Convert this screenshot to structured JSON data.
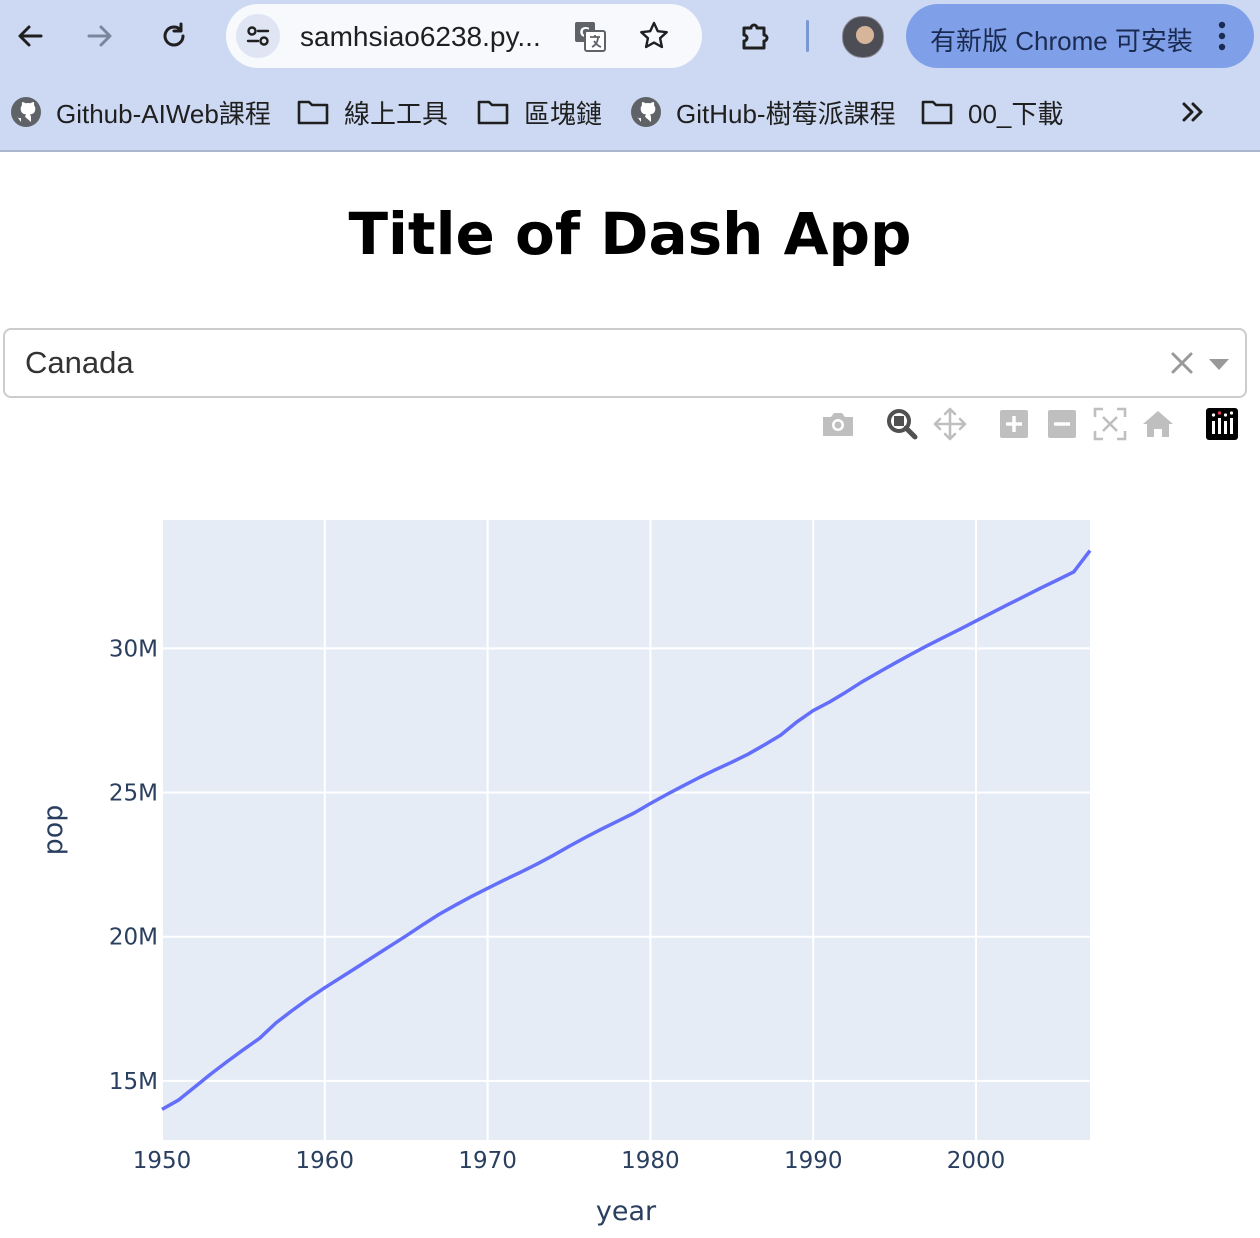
{
  "browser": {
    "url": "samhsiao6238.py...",
    "update_button": "有新版 Chrome 可安裝",
    "bookmarks": [
      {
        "label": "Github-AIWeb課程",
        "icon": "github-icon"
      },
      {
        "label": "線上工具",
        "icon": "folder-icon"
      },
      {
        "label": "區塊鏈",
        "icon": "folder-icon"
      },
      {
        "label": "GitHub-樹莓派課程",
        "icon": "github-icon"
      },
      {
        "label": "00_下載",
        "icon": "folder-icon"
      }
    ],
    "icons": [
      "back-icon",
      "forward-icon",
      "reload-icon",
      "site-info-icon",
      "translate-icon",
      "bookmark-star-icon",
      "extensions-icon",
      "profile-avatar",
      "more-icon",
      "bookmarks-overflow-icon"
    ]
  },
  "page": {
    "title": "Title of Dash App"
  },
  "dropdown": {
    "value": "Canada"
  },
  "modebar": {
    "icons": [
      "camera-icon",
      "zoom-icon",
      "pan-icon",
      "zoom-in-icon",
      "zoom-out-icon",
      "autoscale-icon",
      "reset-axes-icon",
      "plotly-logo-icon"
    ]
  },
  "chart_data": {
    "type": "line",
    "xlabel": "year",
    "ylabel": "pop",
    "x": [
      1950,
      1951,
      1952,
      1953,
      1954,
      1955,
      1956,
      1957,
      1958,
      1959,
      1960,
      1961,
      1962,
      1963,
      1964,
      1965,
      1966,
      1967,
      1968,
      1969,
      1970,
      1971,
      1972,
      1973,
      1974,
      1975,
      1976,
      1977,
      1978,
      1979,
      1980,
      1981,
      1982,
      1983,
      1984,
      1985,
      1986,
      1987,
      1988,
      1989,
      1990,
      1991,
      1992,
      1993,
      1994,
      1995,
      1996,
      1997,
      1998,
      1999,
      2000,
      2001,
      2002,
      2003,
      2004,
      2005,
      2006,
      2007
    ],
    "series": [
      {
        "values": [
          14011422,
          14330000,
          14785584,
          15240000,
          15670000,
          16080000,
          16480000,
          17010298,
          17440000,
          17850000,
          18230000,
          18590000,
          18950000,
          19310000,
          19670000,
          20030000,
          20410000,
          20770000,
          21090000,
          21390000,
          21680000,
          21960000,
          22230000,
          22510000,
          22810000,
          23130000,
          23440000,
          23730000,
          24010000,
          24290000,
          24620000,
          24930000,
          25230000,
          25520000,
          25790000,
          26050000,
          26330000,
          26650000,
          26990000,
          27450000,
          27840000,
          28140000,
          28480000,
          28840000,
          29160000,
          29480000,
          29790000,
          30090000,
          30380000,
          30660000,
          30950000,
          31240000,
          31530000,
          31810000,
          32100000,
          32370000,
          32650000,
          33390141
        ],
        "color": "#636efa"
      }
    ],
    "xlim": [
      1950,
      2007
    ],
    "ylim": [
      12950000,
      34450000
    ],
    "xticks": [
      1950,
      1960,
      1970,
      1980,
      1990,
      2000
    ],
    "xtick_labels": [
      "1950",
      "1960",
      "1970",
      "1980",
      "1990",
      "2000"
    ],
    "yticks": [
      15000000,
      20000000,
      25000000,
      30000000
    ],
    "ytick_labels": [
      "15M",
      "20M",
      "25M",
      "30M"
    ],
    "grid": true,
    "plot_bgcolor": "#e5ecf6"
  }
}
